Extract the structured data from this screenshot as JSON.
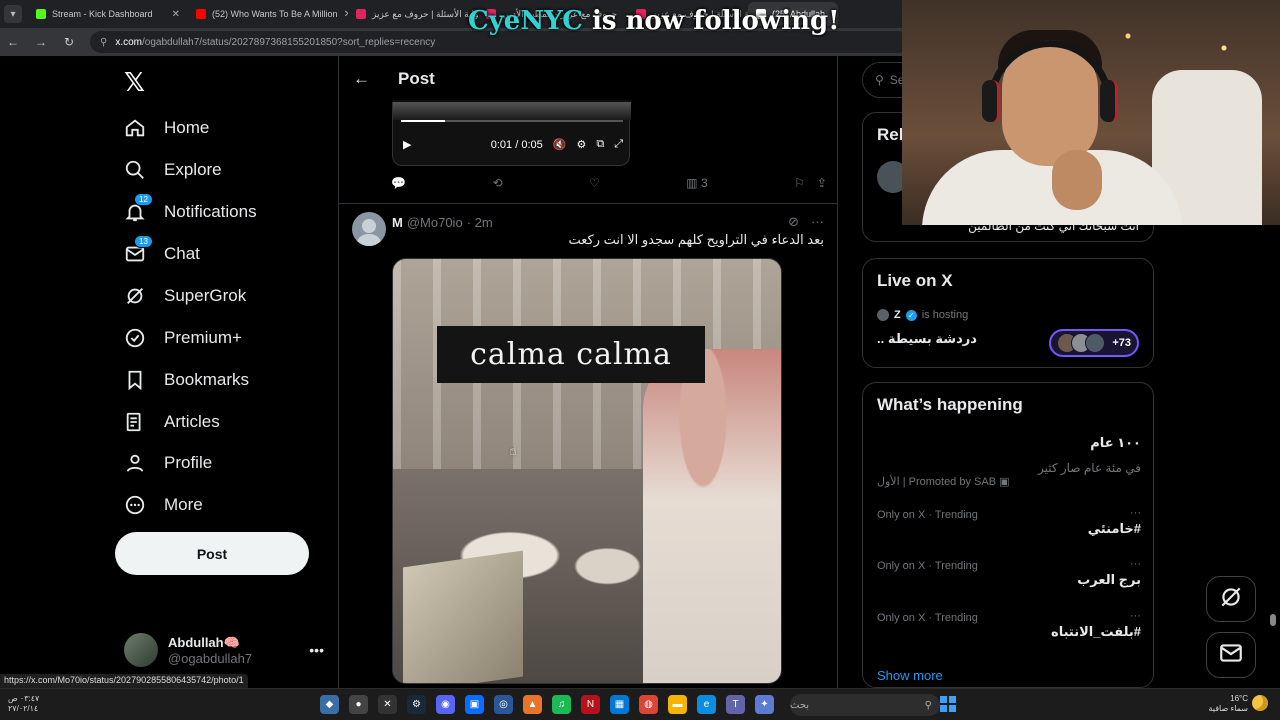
{
  "browser": {
    "tabs": [
      {
        "label": "Stream - Kick Dashboard",
        "icon": "kick-icon",
        "color": "#53fc18"
      },
      {
        "label": "(52) Who Wants To Be A Million",
        "icon": "youtube-icon",
        "color": "#ff0000"
      },
      {
        "label": "بوابة الأسئلة | حروف مع عزيز",
        "icon": "site-icon",
        "color": "#e0245e"
      },
      {
        "label": "حروف مع عزيز - المطبخ الأدبي",
        "icon": "site-icon",
        "color": "#e0245e"
      },
      {
        "label": "بوابة الأسئلة | حروف مع عزيز",
        "icon": "site-icon",
        "color": "#e0245e"
      },
      {
        "label": "(25) Abdullah",
        "icon": "x-icon",
        "color": "#ffffff"
      }
    ],
    "url_host": "x.com",
    "url_path": "/ogabdullah7/status/2027897368155201850?sort_replies=recency"
  },
  "overlay": {
    "name": "CyeNYC",
    "text": " is now following!"
  },
  "sidebar": {
    "logo": "𝕏",
    "items": [
      {
        "label": "Home",
        "icon": "home-icon"
      },
      {
        "label": "Explore",
        "icon": "search-icon"
      },
      {
        "label": "Notifications",
        "icon": "bell-icon",
        "badge": "12"
      },
      {
        "label": "Chat",
        "icon": "mail-icon",
        "badge": "13"
      },
      {
        "label": "SuperGrok",
        "icon": "grok-icon"
      },
      {
        "label": "Premium+",
        "icon": "verified-icon"
      },
      {
        "label": "Bookmarks",
        "icon": "bookmark-icon"
      },
      {
        "label": "Articles",
        "icon": "article-icon"
      },
      {
        "label": "Profile",
        "icon": "person-icon"
      },
      {
        "label": "More",
        "icon": "more-circle-icon"
      }
    ],
    "post_label": "Post",
    "account": {
      "name": "Abdullah🧠",
      "handle": "@ogabdullah7"
    }
  },
  "main": {
    "title": "Post",
    "video": {
      "time": "0:01 / 0:05",
      "progress": 0.2
    },
    "prev_actions": {
      "views": "3"
    },
    "tweet": {
      "name": "M",
      "handle": "@Mo70io",
      "time": "· 2m",
      "text": "بعد الدعاء في التراويح كلهم سجدو الا انت ركعت",
      "media_caption": "calma calma"
    }
  },
  "right": {
    "search_placeholder": "Se",
    "relevant_title": "Rel",
    "relevant_text": "انت سبحانك اني كنت من الظالمين",
    "live": {
      "title": "Live on X",
      "host": "Z",
      "hosting": "is hosting",
      "space": "دردشة بسيطة ..",
      "count": "+73"
    },
    "whats_happening": {
      "title": "What’s happening",
      "trends": [
        {
          "meta": "",
          "name": "١٠٠ عام",
          "sub": "في مئة عام صار كثير",
          "promo": "Promoted by SAB | الأول"
        },
        {
          "meta": "Only on X · Trending",
          "name": "#خامنئي"
        },
        {
          "meta": "Only on X · Trending",
          "name": "برج العرب"
        },
        {
          "meta": "Only on X · Trending",
          "name": "#بلفت_الانتباه"
        }
      ],
      "show_more": "Show more"
    }
  },
  "status_url": "https://x.com/Mo70io/status/2027902855806435742/photo/1",
  "taskbar": {
    "time": "٠٣:٤٧ ص",
    "date": "٢٧/٠٢/١٤",
    "search": "بحث",
    "temp": "16°C",
    "weather": "سماء صافية"
  }
}
